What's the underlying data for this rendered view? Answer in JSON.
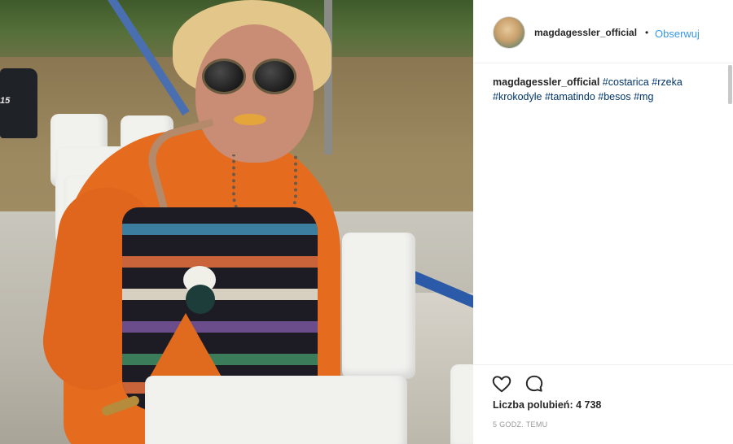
{
  "post": {
    "image_alt_icon": "photo",
    "motor_label": "15"
  },
  "header": {
    "username": "magdagessler_official",
    "separator": "•",
    "follow_label": "Obserwuj"
  },
  "caption": {
    "username": "magdagessler_official",
    "hashtags": [
      "#costarica",
      "#rzeka",
      "#krokodyle",
      "#tamatindo",
      "#besos",
      "#mg"
    ]
  },
  "actions": {
    "like_icon": "heart-icon",
    "comment_icon": "comment-icon",
    "likes_text": "Liczba polubień: 4 738",
    "time_text": "5 GODZ. TEMU"
  },
  "colors": {
    "link": "#3897f0",
    "hashtag": "#003569",
    "text": "#262626",
    "muted": "#999999"
  }
}
